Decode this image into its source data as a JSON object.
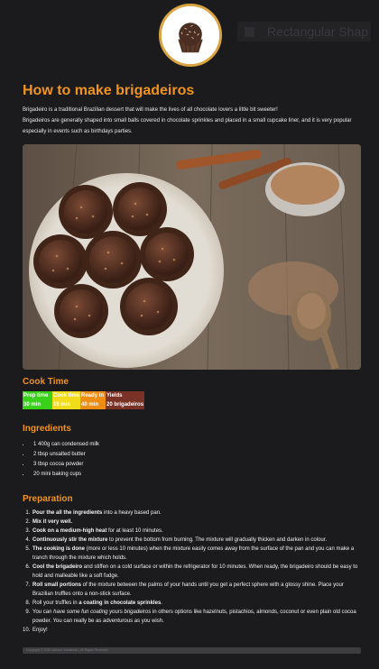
{
  "header": {
    "logo_icon": "brigadeiro-logo",
    "nav_label": "Rectangular Shap"
  },
  "page": {
    "title": "How to make brigadeiros",
    "intro_1": "Brigadeiro is a traditional Brazilian dessert that will make the lives of all chocolate lovers a little bit sweeter!",
    "intro_2": "Brigadeiros are generally shaped into small balls covered in chocolate sprinkles and placed in a small cupcake liner, and it is very popular especially in events such as birthdays parties."
  },
  "hero_image": {
    "subject": "brigadeiros-on-plate-photo"
  },
  "cook_time": {
    "title": "Cook Time",
    "headers": [
      "Prep time",
      "Cook time",
      "Ready in",
      "Yields"
    ],
    "values": [
      "30 min",
      "10 min",
      "40 min",
      "20 brigadeiros"
    ],
    "colors": [
      "#39d11a",
      "#f2db1b",
      "#ef8c12",
      "#7b3226"
    ]
  },
  "ingredients": {
    "title": "Ingredients",
    "items": [
      "1 400g can condensed milk",
      "2 tbsp unsalted butter",
      "3 tbsp cocoa powder",
      "20 mini baking cups"
    ]
  },
  "preparation": {
    "title": "Preparation",
    "steps": [
      {
        "b": "Pour the all the ingredients",
        "t": " into a heavy based pan."
      },
      {
        "b": "Mix it very well.",
        "t": ""
      },
      {
        "b": "Cook on a medium-high heat",
        "t": " for at least 10 minutes."
      },
      {
        "b": "Continuously stir the mixture",
        "t": " to prevent the bottom from burning. The mixture will gradually thicken and darken in colour."
      },
      {
        "b": "The cooking is done",
        "t": " (more or less 10 minutes) when the mixture easily comes away from the surface of the pan and you can make a tranch through the mixture which holds."
      },
      {
        "b": "Cool the brigadeiro",
        "t": " and stiffen on a cold surface or within the refrigerator for 10 minutes. When ready, the brigadeiro should be easy to hold and malleable like a soft fudge."
      },
      {
        "b": "Roll small portions",
        "t": " of the mixture between the palms of your hands until you get a perfect sphere with a glossy shine. Place your Brazilian truffles onto a non-stick surface."
      },
      {
        "b": "",
        "t": "Roll your truffles in ",
        "b2": "a coating in chocolate sprinkles",
        "t2": "."
      },
      {
        "b": "",
        "t": "You can ",
        "i": "have some fun coating yours brigadeiros",
        "t2": " in others options like hazelnuts, pistachios, almonds, coconut or even plain old cocoa powder. You can really be as adventurous as you wish."
      },
      {
        "b": "",
        "t": "Enjoy!"
      }
    ]
  },
  "footer": {
    "text": "Copyright © 2020 Adriana Yoshimoto | All Rights Reserved"
  }
}
